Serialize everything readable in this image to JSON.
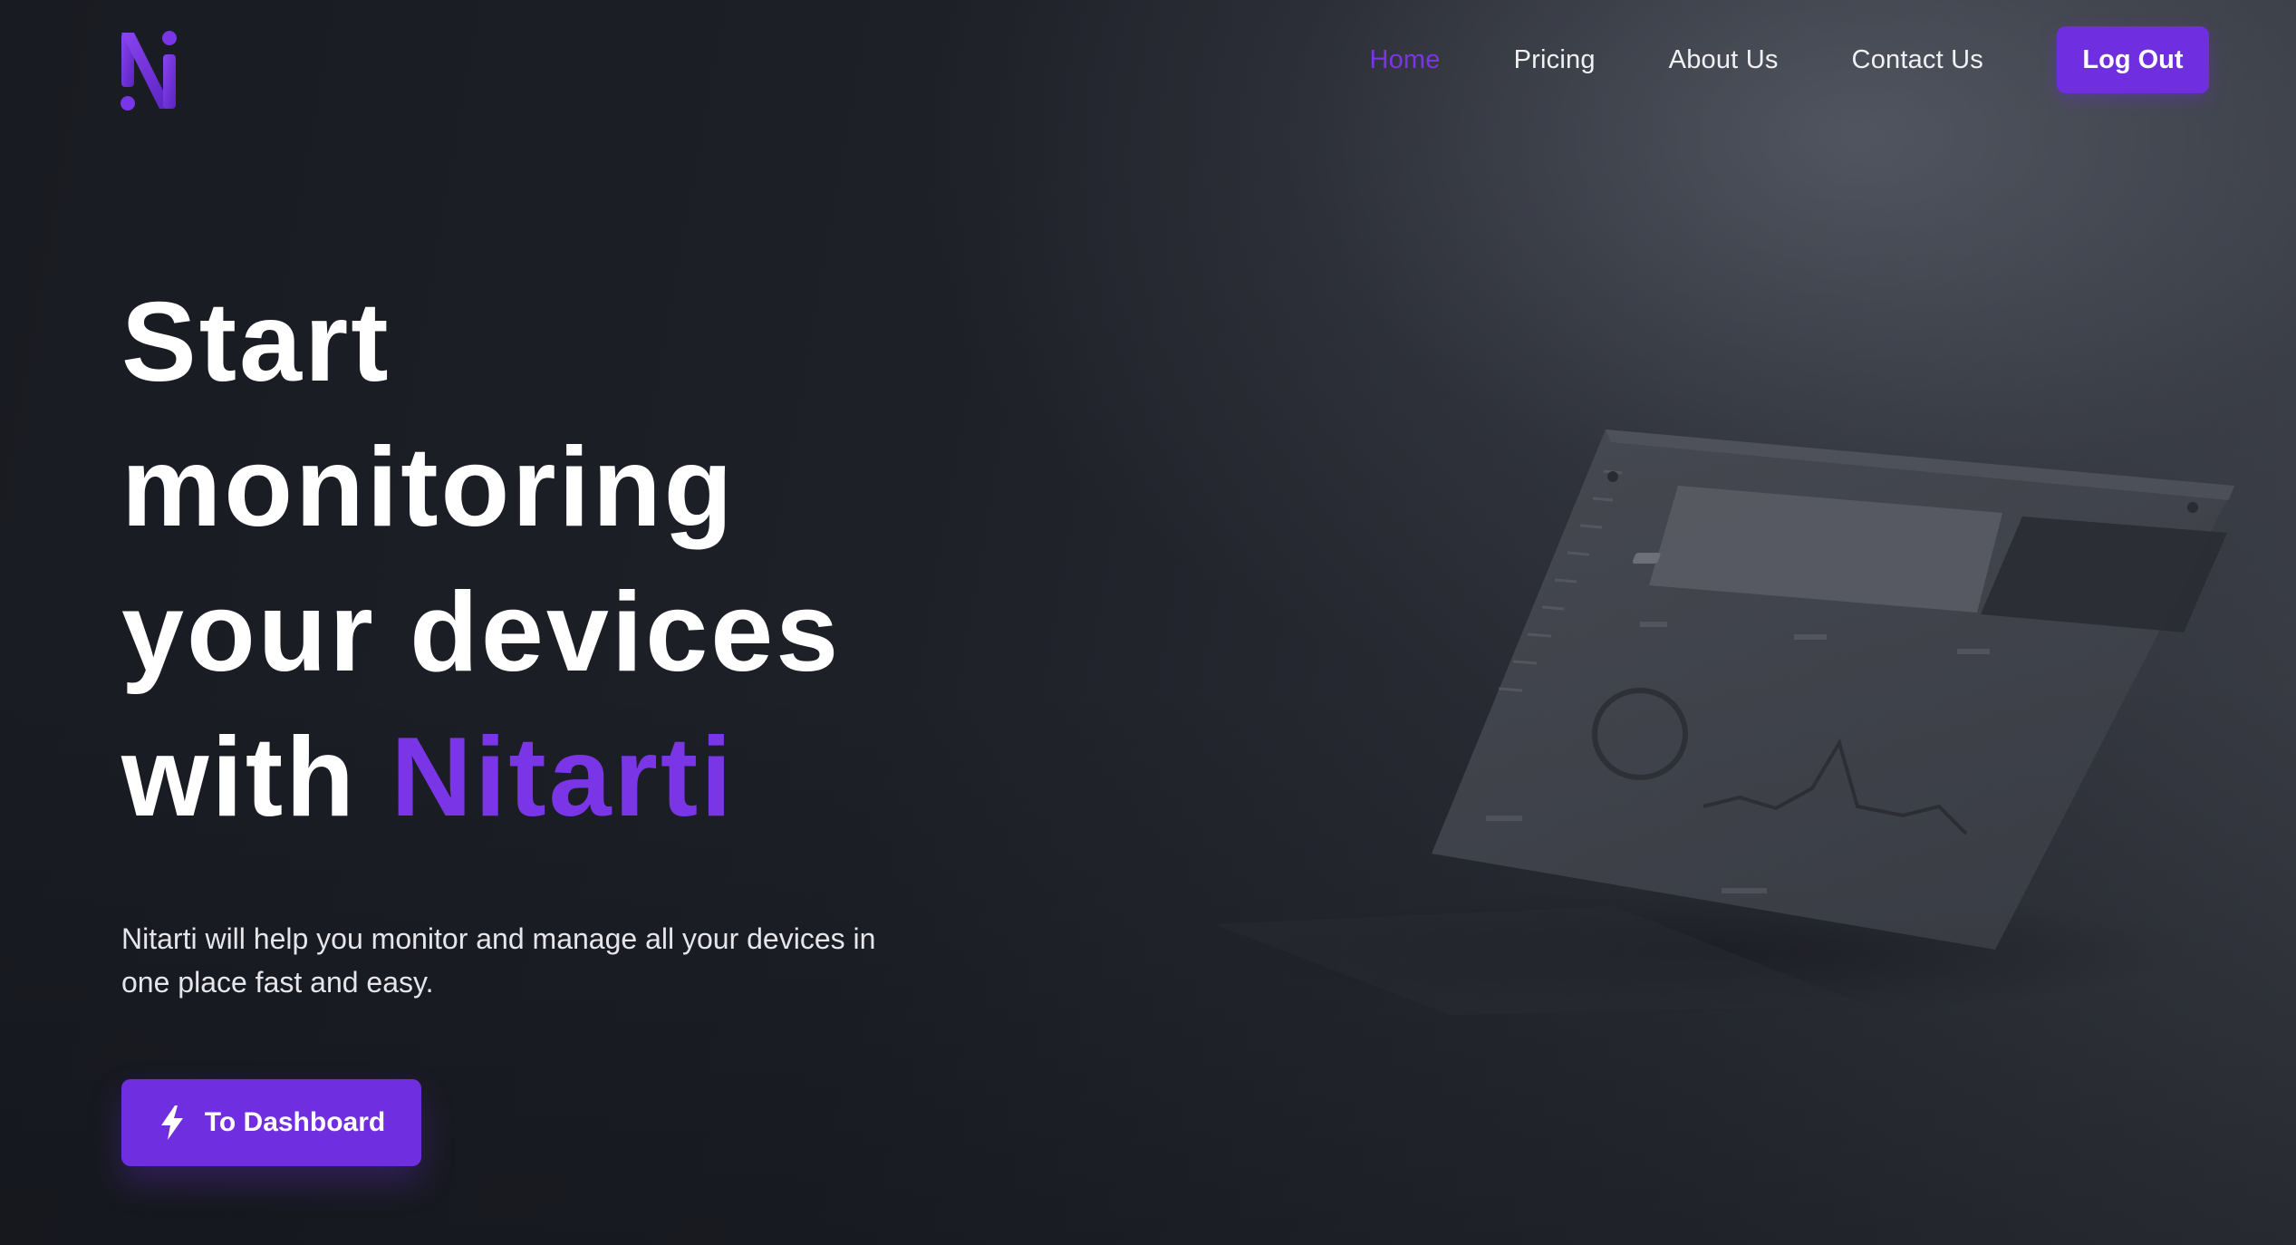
{
  "brand": {
    "logo_icon": "nitarti-logo-icon",
    "accent_color": "#7a35e6",
    "button_color": "#6f2fe0"
  },
  "nav": {
    "items": [
      {
        "label": "Home",
        "active": true
      },
      {
        "label": "Pricing",
        "active": false
      },
      {
        "label": "About Us",
        "active": false
      },
      {
        "label": "Contact Us",
        "active": false
      }
    ],
    "logout_label": "Log Out"
  },
  "hero": {
    "title_lines": [
      "Start",
      "monitoring",
      "your devices",
      "with "
    ],
    "title_accent": "Nitarti",
    "description": "Nitarti will help you monitor and manage all your devices in one place fast and easy.",
    "cta_label": "To Dashboard",
    "cta_icon": "lightning-bolt-icon"
  },
  "mockup": {
    "icon": "dashboard-preview-image"
  }
}
